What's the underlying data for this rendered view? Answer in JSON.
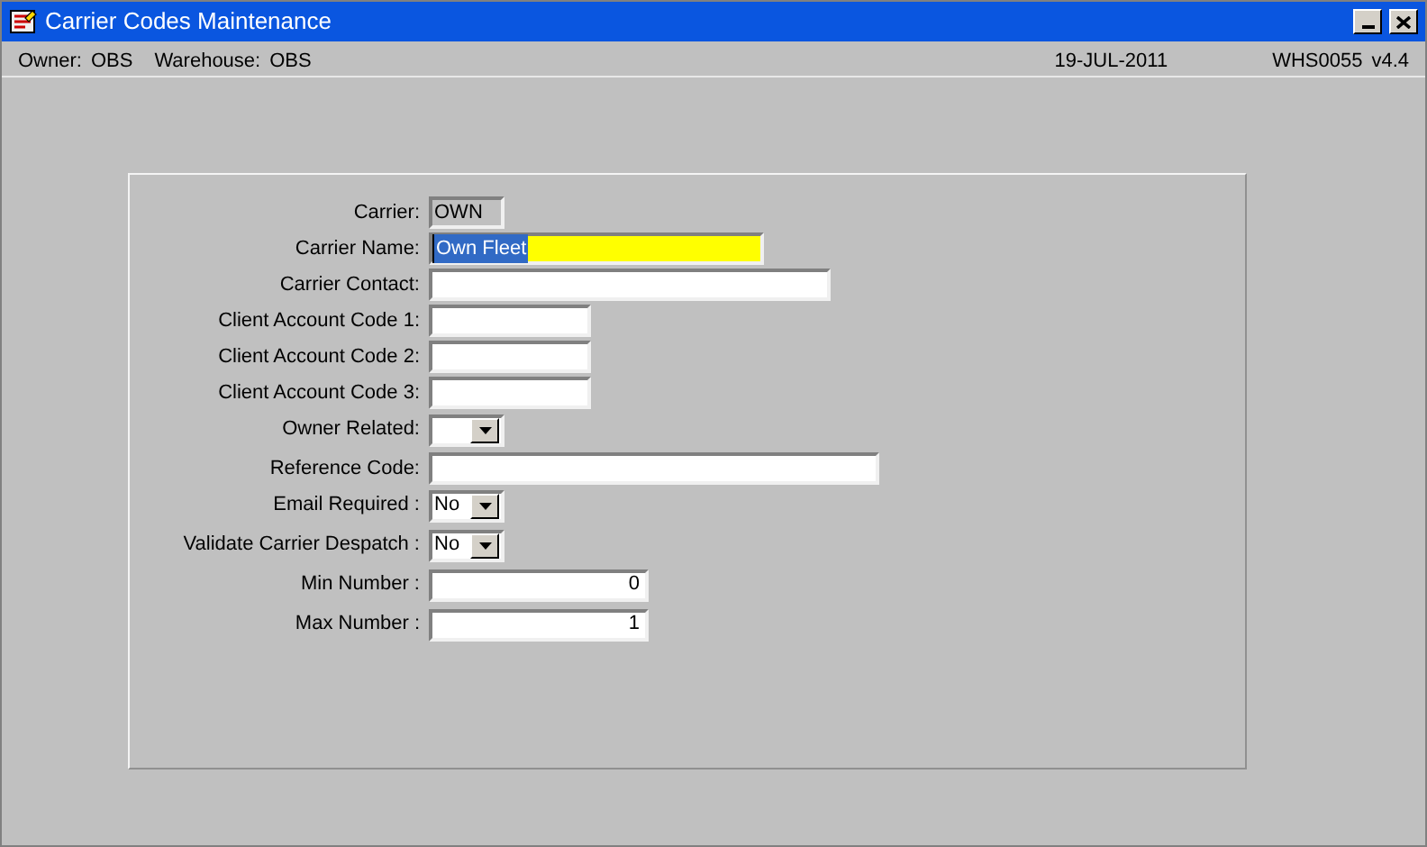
{
  "window": {
    "title": "Carrier Codes Maintenance"
  },
  "header": {
    "owner_label": "Owner:",
    "owner": "OBS",
    "warehouse_label": "Warehouse:",
    "warehouse": "OBS",
    "date": "19-JUL-2011",
    "screen_code": "WHS0055",
    "version": "v4.4"
  },
  "fields": [
    {
      "label": "Carrier:",
      "kind": "readonly",
      "value": "OWN",
      "focused": false
    },
    {
      "label": "Carrier Name:",
      "kind": "text",
      "value": "Own Fleet",
      "focused": true
    },
    {
      "label": "Carrier Contact:",
      "kind": "text",
      "focused": false
    },
    {
      "label": "Client Account Code 1:",
      "kind": "text",
      "focused": false
    },
    {
      "label": "Client Account Code 2:",
      "kind": "text",
      "focused": false
    },
    {
      "label": "Client Account Code 3:",
      "kind": "text",
      "focused": false
    },
    {
      "label": "Owner Related:",
      "kind": "dropdown",
      "focused": false
    },
    {
      "label": "Reference Code:",
      "kind": "text",
      "focused": false
    },
    {
      "label": "Email Required :",
      "kind": "dropdown",
      "value": "No",
      "focused": false
    },
    {
      "label": "Validate Carrier Despatch :",
      "kind": "dropdown",
      "value": "No",
      "focused": false
    },
    {
      "label": "Min Number :",
      "kind": "number",
      "value": "0",
      "focused": false
    },
    {
      "label": "Max Number :",
      "kind": "number",
      "value": "1",
      "focused": false
    }
  ]
}
